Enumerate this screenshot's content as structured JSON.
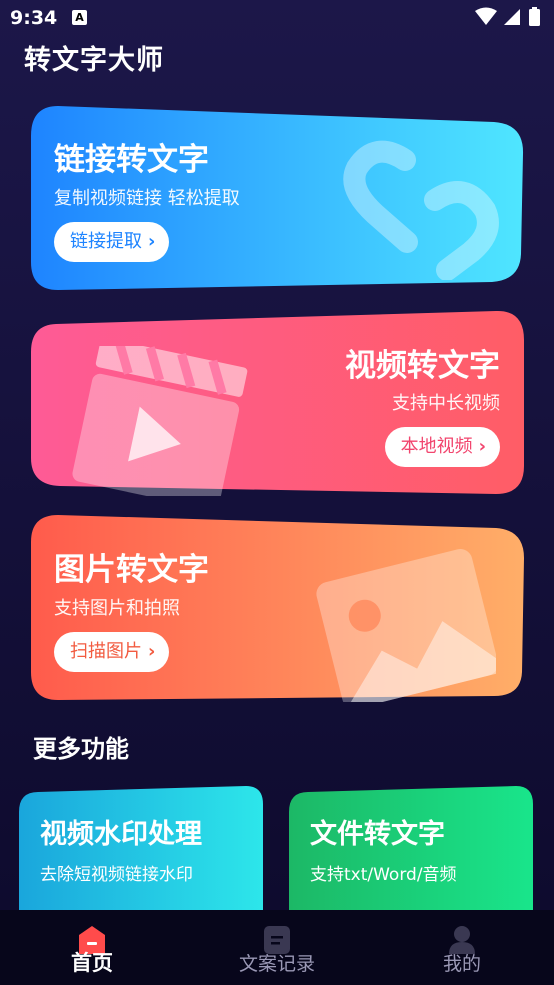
{
  "status_bar": {
    "time": "9:34",
    "notif_letter": "A"
  },
  "app": {
    "title": "转文字大师"
  },
  "cards": {
    "link": {
      "title": "链接转文字",
      "subtitle": "复制视频链接 轻松提取",
      "button": "链接提取",
      "icon": "link-icon",
      "colors": [
        "#1e84ff",
        "#4fe6ff"
      ],
      "button_color": "#1e84ff"
    },
    "video": {
      "title": "视频转文字",
      "subtitle": "支持中长视频",
      "button": "本地视频",
      "icon": "clapperboard-icon",
      "colors": [
        "#fe5b96",
        "#ff5d66"
      ],
      "button_color": "#f2456e"
    },
    "image": {
      "title": "图片转文字",
      "subtitle": "支持图片和拍照",
      "button": "扫描图片",
      "icon": "image-icon",
      "colors": [
        "#ff5b4c",
        "#ffae68"
      ],
      "button_color": "#f25b40"
    }
  },
  "more": {
    "title": "更多功能",
    "items": [
      {
        "title": "视频水印处理",
        "subtitle": "去除短视频链接水印",
        "colors": [
          "#1aa6dc",
          "#2de6ea"
        ]
      },
      {
        "title": "文件转文字",
        "subtitle": "支持txt/Word/音频",
        "colors": [
          "#1cb866",
          "#19e58b"
        ]
      }
    ]
  },
  "tabs": [
    {
      "label": "首页",
      "icon": "home-icon",
      "active": true,
      "color": "#ff4b4b"
    },
    {
      "label": "文案记录",
      "icon": "document-icon",
      "active": false
    },
    {
      "label": "我的",
      "icon": "profile-icon",
      "active": false
    }
  ]
}
